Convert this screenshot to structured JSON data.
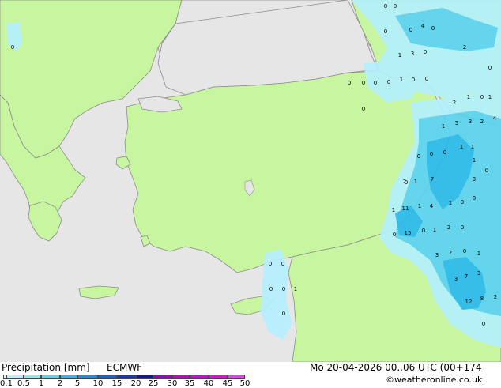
{
  "footer": {
    "title": "Precipitation [mm]",
    "model": "ECMWF",
    "valid_time": "Mo 20-04-2026 00..06 UTC (00+174",
    "credit": "©weatheronline.co.uk"
  },
  "colorbar": {
    "labels": [
      "0.1",
      "0.5",
      "1",
      "2",
      "5",
      "10",
      "15",
      "20",
      "25",
      "30",
      "35",
      "40",
      "45",
      "50"
    ],
    "colors": [
      "#e6f9ff",
      "#b4f0ff",
      "#8ce6fa",
      "#5ad2f5",
      "#28b9f0",
      "#1e8ce6",
      "#1464d2",
      "#0a3cbe",
      "#001ea0",
      "#a000c8",
      "#c800c8",
      "#dc00dc",
      "#f000f0",
      "#ff32ff"
    ]
  },
  "map": {
    "colors": {
      "sea": "#e6e6e6",
      "land": "#c8f5a0",
      "coast": "#8c8c8c",
      "precip_light": "#b4f0ff",
      "precip_mid": "#5ad2f5",
      "precip_heavy": "#28b9f0"
    },
    "amounts": [
      "0",
      "0",
      "0",
      "0",
      "4",
      "0",
      "0",
      "2",
      "1",
      "3",
      "0",
      "0",
      "0",
      "0",
      "0",
      "0",
      "1",
      "0",
      "0",
      "0",
      "0",
      "1",
      "1",
      "2",
      "1",
      "5",
      "3",
      "2",
      "4",
      "1",
      "1",
      "0",
      "0",
      "0",
      "1",
      "0",
      "7",
      "2",
      "1",
      "3",
      "0",
      "1",
      "1",
      "4",
      "1",
      "0",
      "0",
      "11",
      "0",
      "15",
      "0",
      "1",
      "2",
      "0",
      "3",
      "2",
      "0",
      "1",
      "3",
      "7",
      "3",
      "12",
      "8",
      "2",
      "0",
      "0",
      "0",
      "0",
      "0",
      "1",
      "0"
    ]
  }
}
